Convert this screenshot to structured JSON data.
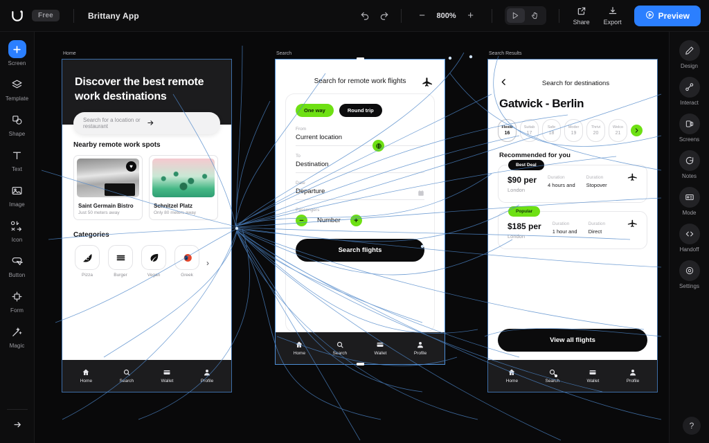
{
  "topbar": {
    "logo_icon": "u-logo-icon",
    "plan_badge": "Free",
    "project_title": "Brittany App",
    "undo_icon": "undo-icon",
    "redo_icon": "redo-icon",
    "zoom_out": "−",
    "zoom_level": "800%",
    "zoom_in": "+",
    "mode_cursor_icon": "cursor-play-icon",
    "mode_hand_icon": "hand-icon",
    "share_label": "Share",
    "share_icon": "share-icon",
    "export_label": "Export",
    "export_icon": "download-icon",
    "preview_label": "Preview",
    "preview_icon": "play-icon",
    "accent_blue": "#2b7fff"
  },
  "left_sidebar": {
    "items": [
      {
        "label": "Screen",
        "icon": "plus-icon",
        "primary": true
      },
      {
        "label": "Template",
        "icon": "layers-icon",
        "primary": false
      },
      {
        "label": "Shape",
        "icon": "shapes-icon",
        "primary": false
      },
      {
        "label": "Text",
        "icon": "text-icon",
        "primary": false
      },
      {
        "label": "Image",
        "icon": "image-icon",
        "primary": false
      },
      {
        "label": "Icon",
        "icon": "icon-grid-icon",
        "primary": false
      },
      {
        "label": "Button",
        "icon": "button-icon",
        "primary": false
      },
      {
        "label": "Form",
        "icon": "form-icon",
        "primary": false
      },
      {
        "label": "Magic",
        "icon": "magic-wand-icon",
        "primary": false
      }
    ],
    "expand_icon": "arrow-right-icon"
  },
  "right_sidebar": {
    "items": [
      {
        "label": "Design",
        "icon": "pencil-icon"
      },
      {
        "label": "Interact",
        "icon": "link-nodes-icon"
      },
      {
        "label": "Screens",
        "icon": "screens-icon"
      },
      {
        "label": "Notes",
        "icon": "comment-icon"
      },
      {
        "label": "Mode",
        "icon": "mode-icon"
      },
      {
        "label": "Handoff",
        "icon": "code-icon"
      },
      {
        "label": "Settings",
        "icon": "gear-icon"
      }
    ],
    "help_label": "?"
  },
  "canvas": {
    "frames": [
      {
        "label": "Home"
      },
      {
        "label": "Search"
      },
      {
        "label": "Search Results"
      }
    ]
  },
  "screen_home": {
    "title": "Discover the best remote work destinations",
    "search_placeholder": "Search for a location or restaurant",
    "search_arrow_icon": "arrow-right-icon",
    "nearby_title": "Nearby remote work spots",
    "cards": [
      {
        "name": "Saint Germain Bistro",
        "sub": "Just 50 meters away",
        "favorite_icon": "heart-icon"
      },
      {
        "name": "Schnitzel Platz",
        "sub": "Only 80 meters away"
      }
    ],
    "categories_title": "Categories",
    "categories": [
      {
        "label": "Pizza",
        "icon": "pizza-icon",
        "glyph": "🍕"
      },
      {
        "label": "Burger",
        "icon": "burger-icon",
        "glyph": "≡"
      },
      {
        "label": "Vegan",
        "icon": "leaf-icon",
        "glyph": "🌿"
      },
      {
        "label": "Greek",
        "icon": "olive-icon",
        "glyph": "🫒"
      }
    ],
    "categories_next_icon": "chevron-right-icon",
    "nav": [
      {
        "label": "Home",
        "icon": "home-icon"
      },
      {
        "label": "Search",
        "icon": "search-icon"
      },
      {
        "label": "Wallet",
        "icon": "wallet-icon"
      },
      {
        "label": "Profile",
        "icon": "profile-icon"
      }
    ]
  },
  "screen_search": {
    "title": "Search for remote work flights",
    "plane_icon": "plane-icon",
    "trip_types": [
      {
        "label": "One way",
        "selected": true
      },
      {
        "label": "Round trip",
        "selected": false
      }
    ],
    "from_label": "From",
    "from_value": "Current location",
    "swap_icon": "globe-icon",
    "to_label": "To",
    "to_value": "Destination",
    "date_label": "Date",
    "date_value": "Departure",
    "calendar_icon": "calendar-icon",
    "passengers_label": "Passengers",
    "passengers_value": "Number",
    "minus_label": "−",
    "plus_label": "+",
    "submit_label": "Search flights",
    "nav": [
      {
        "label": "Home",
        "icon": "home-icon"
      },
      {
        "label": "Search",
        "icon": "search-icon"
      },
      {
        "label": "Wallet",
        "icon": "wallet-icon"
      },
      {
        "label": "Profile",
        "icon": "profile-icon"
      }
    ]
  },
  "screen_results": {
    "back_icon": "chevron-left-icon",
    "title": "Search for destinations",
    "route": "Gatwick - Berlin",
    "date_chips": [
      {
        "day": "Flexib",
        "num": "16",
        "active": true
      },
      {
        "day": "Suitab",
        "num": "17",
        "active": false
      },
      {
        "day": "Safe",
        "num": "18",
        "active": false
      },
      {
        "day": "Moder",
        "num": "19",
        "active": false
      },
      {
        "day": "Thrivi",
        "num": "20",
        "active": false
      },
      {
        "day": "Welco",
        "num": "21",
        "active": false
      }
    ],
    "chips_next_icon": "chevron-right-circle-icon",
    "recommended_title": "Recommended for you",
    "flights": [
      {
        "badge": "Best Deal",
        "badge_style": "dark",
        "price": "$90 per",
        "city": "London",
        "k1": "Duration",
        "v1": "4 hours and",
        "k2": "Duration",
        "v2": "Stopover",
        "plane_icon": "plane-icon"
      },
      {
        "badge": "Popular",
        "badge_style": "green",
        "price": "$185 per",
        "city": "London",
        "k1": "Duration",
        "v1": "1 hour and",
        "k2": "Duration",
        "v2": "Direct",
        "plane_icon": "plane-icon"
      }
    ],
    "cta_label": "View all flights",
    "nav": [
      {
        "label": "Home",
        "icon": "home-icon"
      },
      {
        "label": "Search",
        "icon": "search-icon"
      },
      {
        "label": "Wallet",
        "icon": "wallet-icon"
      },
      {
        "label": "Profile",
        "icon": "profile-icon"
      }
    ]
  }
}
